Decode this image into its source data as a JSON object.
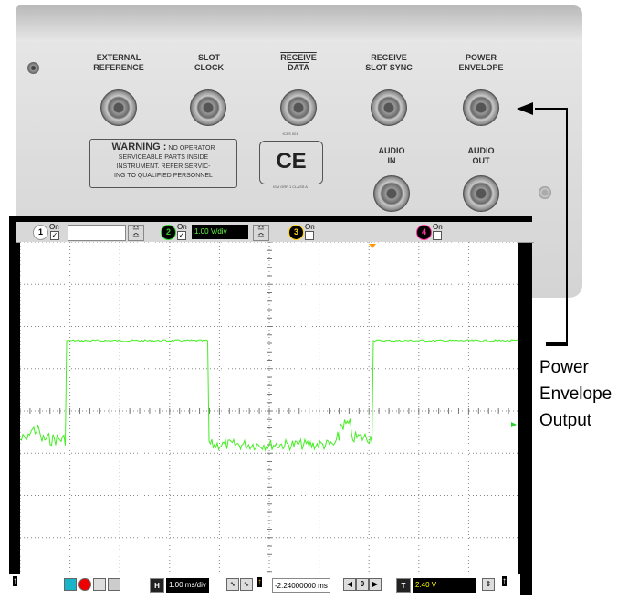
{
  "rear_panel": {
    "connectors": [
      {
        "label_line1": "EXTERNAL",
        "label_line2": "REFERENCE"
      },
      {
        "label_line1": "SLOT",
        "label_line2": "CLOCK"
      },
      {
        "label_line1": "RECEIVE",
        "label_line2": "DATA"
      },
      {
        "label_line1": "RECEIVE",
        "label_line2": "SLOT SYNC"
      },
      {
        "label_line1": "POWER",
        "label_line2": "ENVELOPE"
      },
      {
        "label_line1": "AUDIO",
        "label_line2": "IN"
      },
      {
        "label_line1": "AUDIO",
        "label_line2": "OUT"
      }
    ],
    "warning": {
      "title": "WARNING :",
      "text_line1": "NO OPERATOR",
      "text_line2": "SERVICEABLE PARTS INSIDE",
      "text_line3": "INSTRUMENT. REFER SERVIC-",
      "text_line4": "ING TO QUALIFIED PERSONNEL"
    },
    "ce_mark": "CE",
    "ce_top": "ICES 001",
    "ce_bottom": "ISM GRP 1 CLASS A"
  },
  "scope": {
    "channels": [
      {
        "number": "1",
        "on_label": "On",
        "checked": true,
        "scale": "",
        "color": "#ffffff"
      },
      {
        "number": "2",
        "on_label": "On",
        "checked": true,
        "scale": "1.00 V/div",
        "color": "#2fd22f"
      },
      {
        "number": "3",
        "on_label": "On",
        "checked": false,
        "scale": "",
        "color": "#ffd400"
      },
      {
        "number": "4",
        "on_label": "On",
        "checked": false,
        "scale": "",
        "color": "#ff2fa0"
      }
    ],
    "timebase_label": "H",
    "timebase": "1.00 ms/div",
    "position": "-2.24000000 ms",
    "trigger_label": "T",
    "trigger_level": "2.40 V",
    "trace_color": "#44ee22"
  },
  "callout": {
    "line1": "Power",
    "line2": "Envelope",
    "line3": "Output"
  }
}
